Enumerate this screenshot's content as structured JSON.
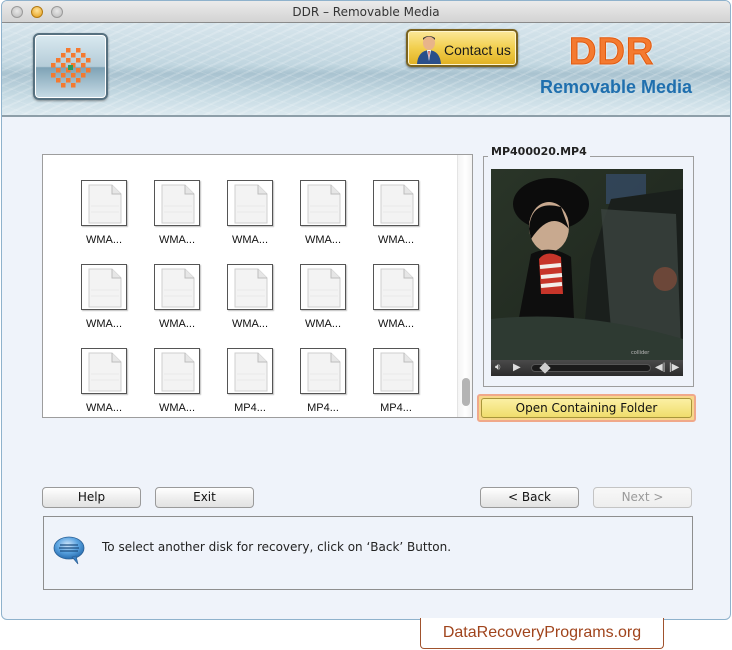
{
  "window": {
    "title": "DDR – Removable Media"
  },
  "header": {
    "contact_label": "Contact us",
    "brand": "DDR",
    "product": "Removable Media",
    "logo_icon": "orange-checker-burst-icon",
    "contact_icon": "businessman-icon"
  },
  "files": {
    "partial_row": [
      "WMA...",
      "WMA...",
      "WMA...",
      "WMA...",
      "WMA..."
    ],
    "rows": [
      [
        "WMA...",
        "WMA...",
        "WMA...",
        "WMA...",
        "WMA..."
      ],
      [
        "WMA...",
        "WMA...",
        "WMA...",
        "WMA...",
        "WMA..."
      ],
      [
        "WMA...",
        "WMA...",
        "MP4...",
        "MP4...",
        "MP4..."
      ]
    ],
    "file_icon": "generic-document-icon"
  },
  "preview": {
    "filename": "MP400020.MP4",
    "open_folder_label": "Open Containing Folder",
    "seek_position": 0.08,
    "controls": [
      "volume-icon",
      "play-icon",
      "seek-slider",
      "step-back-icon",
      "step-forward-icon"
    ]
  },
  "buttons": {
    "help": "Help",
    "exit": "Exit",
    "back": "< Back",
    "next": "Next >"
  },
  "message": {
    "text": "To select another disk for recovery, click on ‘Back’ Button.",
    "icon": "speech-bubble-icon"
  },
  "watermark": {
    "text": "DataRecoveryPrograms.org"
  },
  "colors": {
    "brand_orange": "#f47a30",
    "brand_blue": "#1f6fae",
    "background": "#eff3fa",
    "watermark": "#a0441c"
  }
}
